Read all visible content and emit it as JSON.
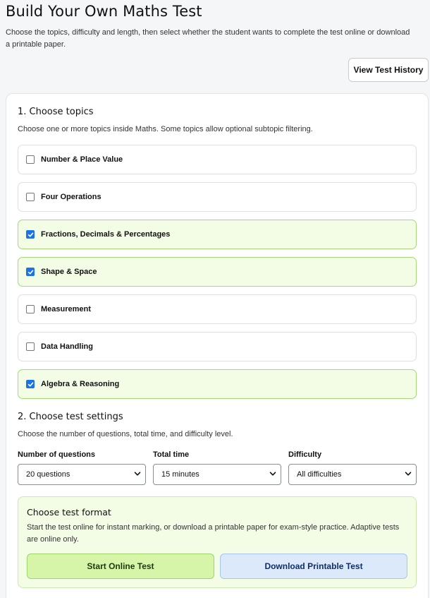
{
  "header": {
    "title": "Build Your Own Maths Test",
    "description": "Choose the topics, difficulty and length, then select whether the student wants to complete the test online or download a printable paper.",
    "history_button": "View Test History"
  },
  "topics_section": {
    "title": "1. Choose topics",
    "description": "Choose one or more topics inside Maths. Some topics allow optional subtopic filtering.",
    "items": [
      {
        "label": "Number & Place Value",
        "checked": false
      },
      {
        "label": "Four Operations",
        "checked": false
      },
      {
        "label": "Fractions, Decimals & Percentages",
        "checked": true
      },
      {
        "label": "Shape & Space",
        "checked": true
      },
      {
        "label": "Measurement",
        "checked": false
      },
      {
        "label": "Data Handling",
        "checked": false
      },
      {
        "label": "Algebra & Reasoning",
        "checked": true
      }
    ]
  },
  "settings_section": {
    "title": "2. Choose test settings",
    "description": "Choose the number of questions, total time, and difficulty level.",
    "questions": {
      "label": "Number of questions",
      "value": "20 questions"
    },
    "time": {
      "label": "Total time",
      "value": "15 minutes"
    },
    "difficulty": {
      "label": "Difficulty",
      "value": "All difficulties"
    }
  },
  "format_section": {
    "title": "Choose test format",
    "description": "Start the test online for instant marking, or download a printable paper for exam-style practice. Adaptive tests are online only.",
    "start_button": "Start Online Test",
    "download_button": "Download Printable Test"
  },
  "colors": {
    "selected_bg": "#f3fde6",
    "selected_border": "#a8d67a",
    "checkbox_accent": "#1a73e8",
    "start_button_bg": "#d7f5a8",
    "download_button_bg": "#dbe9fb"
  },
  "icons": {
    "checkbox_check": "check-icon",
    "select_arrow": "chevron-down-icon"
  }
}
